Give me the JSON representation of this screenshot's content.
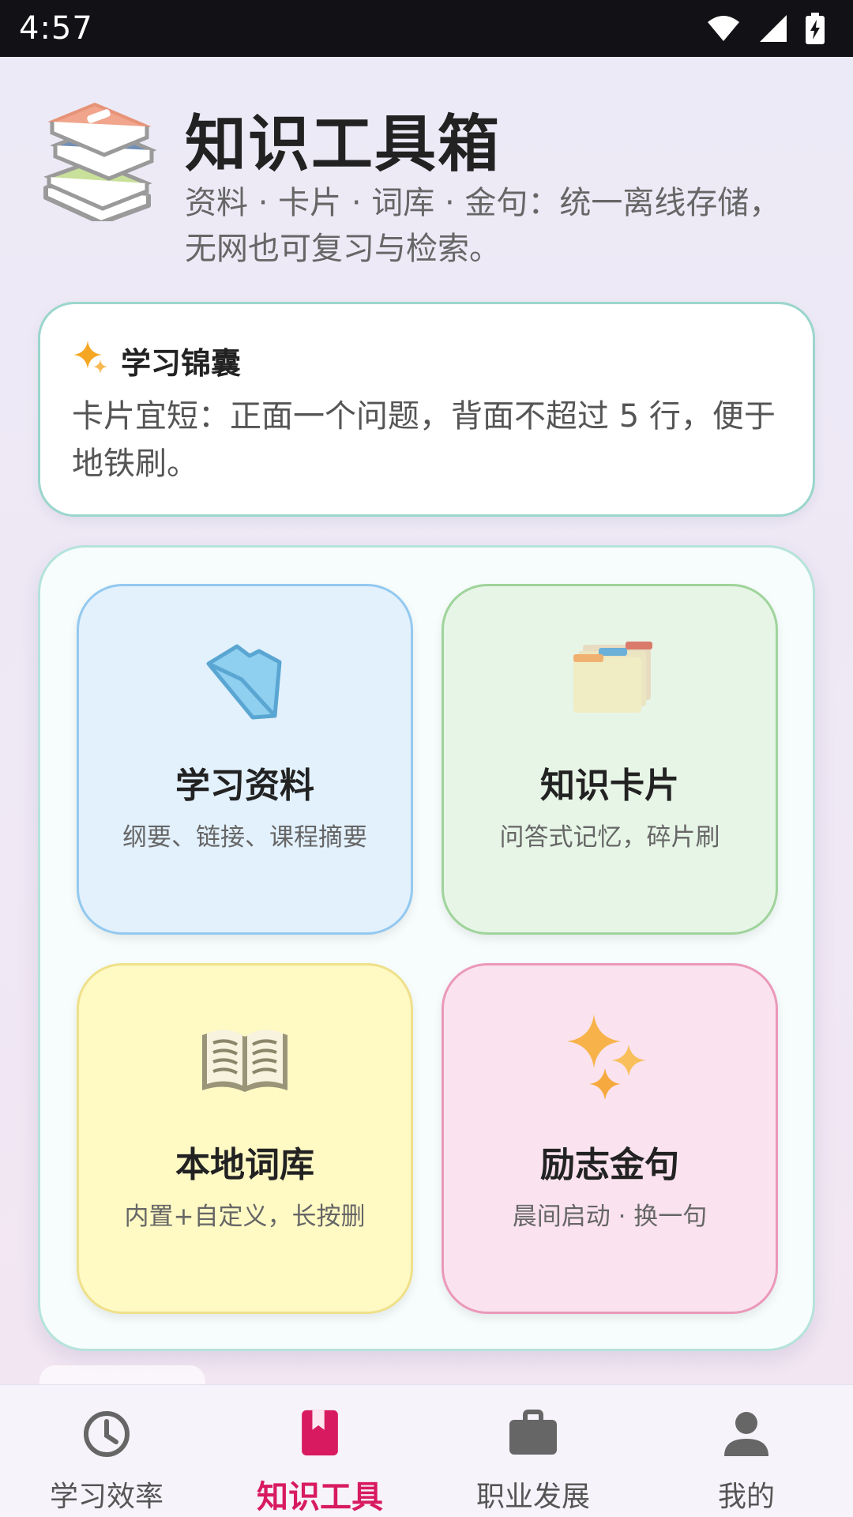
{
  "status_bar": {
    "time": "4:57"
  },
  "header": {
    "title": "知识工具箱",
    "subtitle": "资料 · 卡片 · 词库 · 金句：统一离线存储，无网也可复习与检索。"
  },
  "tip": {
    "title": "学习锦囊",
    "body": "卡片宜短：正面一个问题，背面不超过 5 行，便于地铁刷。"
  },
  "tiles": [
    {
      "title": "学习资料",
      "desc": "纲要、链接、课程摘要",
      "icon": "folder-icon"
    },
    {
      "title": "知识卡片",
      "desc": "问答式记忆，碎片刷",
      "icon": "card-index-icon"
    },
    {
      "title": "本地词库",
      "desc": "内置+自定义，长按删",
      "icon": "open-book-icon"
    },
    {
      "title": "励志金句",
      "desc": "晨间启动 · 换一句",
      "icon": "sparkles-icon"
    }
  ],
  "nav": [
    {
      "label": "学习效率",
      "icon": "clock-icon",
      "active": false
    },
    {
      "label": "知识工具",
      "icon": "book-icon",
      "active": true
    },
    {
      "label": "职业发展",
      "icon": "briefcase-icon",
      "active": false
    },
    {
      "label": "我的",
      "icon": "person-icon",
      "active": false
    }
  ],
  "colors": {
    "accent": "#d81b60",
    "materials_bg": "#e3f1fd",
    "cards_bg": "#e7f5e7",
    "vocab_bg": "#fff9c4",
    "quotes_bg": "#fae3ee"
  }
}
